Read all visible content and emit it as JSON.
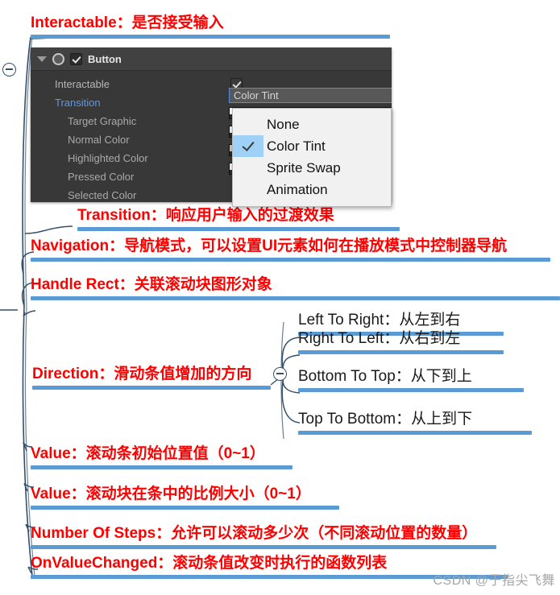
{
  "mindmap": {
    "root_toggle_icon": "collapse-minus-icon",
    "direction_toggle_icon": "collapse-minus-icon",
    "nodes": [
      {
        "id": "interactable",
        "text": "Interactable：是否接受输入"
      },
      {
        "id": "transition",
        "text": "Transition：响应用户输入的过渡效果"
      },
      {
        "id": "navigation",
        "text": "Navigation：导航模式，可以设置UI元素如何在播放模式中控制器导航"
      },
      {
        "id": "handle_rect",
        "text": "Handle Rect：关联滚动块图形对象"
      },
      {
        "id": "direction",
        "text": "Direction：滑动条值增加的方向"
      },
      {
        "id": "value_position",
        "text": "Value：滚动条初始位置值（0~1）"
      },
      {
        "id": "value_size",
        "text": "Value：滚动块在条中的比例大小（0~1）"
      },
      {
        "id": "number_of_steps",
        "text": "Number Of Steps：允许可以滚动多少次（不同滚动位置的数量）"
      },
      {
        "id": "on_value_changed",
        "text": "OnValueChanged：滚动条值改变时执行的函数列表"
      }
    ],
    "direction_children": [
      {
        "id": "left_to_right",
        "text": "Left To Right：从左到右"
      },
      {
        "id": "right_to_left",
        "text": "Right To Left：从右到左"
      },
      {
        "id": "bottom_to_top",
        "text": "Bottom To Top：从下到上"
      },
      {
        "id": "top_to_bottom",
        "text": "Top To Bottom：从上到下"
      }
    ],
    "colors": {
      "node_text": "#ff0000",
      "child_text": "#1a1a1a",
      "underline": "#5b9bd5",
      "branch_line": "#34506b"
    }
  },
  "inspector": {
    "component_title": "Button",
    "foldout_icon": "foldout-triangle-icon",
    "component_icon": "button-component-icon",
    "enabled_checkbox_icon": "check-icon",
    "rows": [
      {
        "label": "Interactable",
        "type": "checkbox",
        "checked": true
      },
      {
        "label": "Transition",
        "type": "enum",
        "selected": true
      },
      {
        "label": "Target Graphic",
        "type": "object"
      },
      {
        "label": "Normal Color",
        "type": "color"
      },
      {
        "label": "Highlighted Color",
        "type": "color"
      },
      {
        "label": "Pressed Color",
        "type": "color"
      },
      {
        "label": "Selected Color",
        "type": "color"
      }
    ],
    "transition_value": "Color Tint",
    "colors": {
      "panel_bg": "#383838",
      "header_bg": "#414141",
      "label": "#b6b6b6",
      "selected_label": "#5b9ae8",
      "focus_border": "#4a90e2"
    }
  },
  "dropdown": {
    "name": "transition-dropdown",
    "selected": "Color Tint",
    "items": [
      {
        "label": "None",
        "checked": false
      },
      {
        "label": "Color Tint",
        "checked": true
      },
      {
        "label": "Sprite Swap",
        "checked": false
      },
      {
        "label": "Animation",
        "checked": false
      }
    ],
    "highlight_color": "#9fd0f5"
  },
  "watermark": {
    "text": "CSDN @于指尖飞舞"
  }
}
